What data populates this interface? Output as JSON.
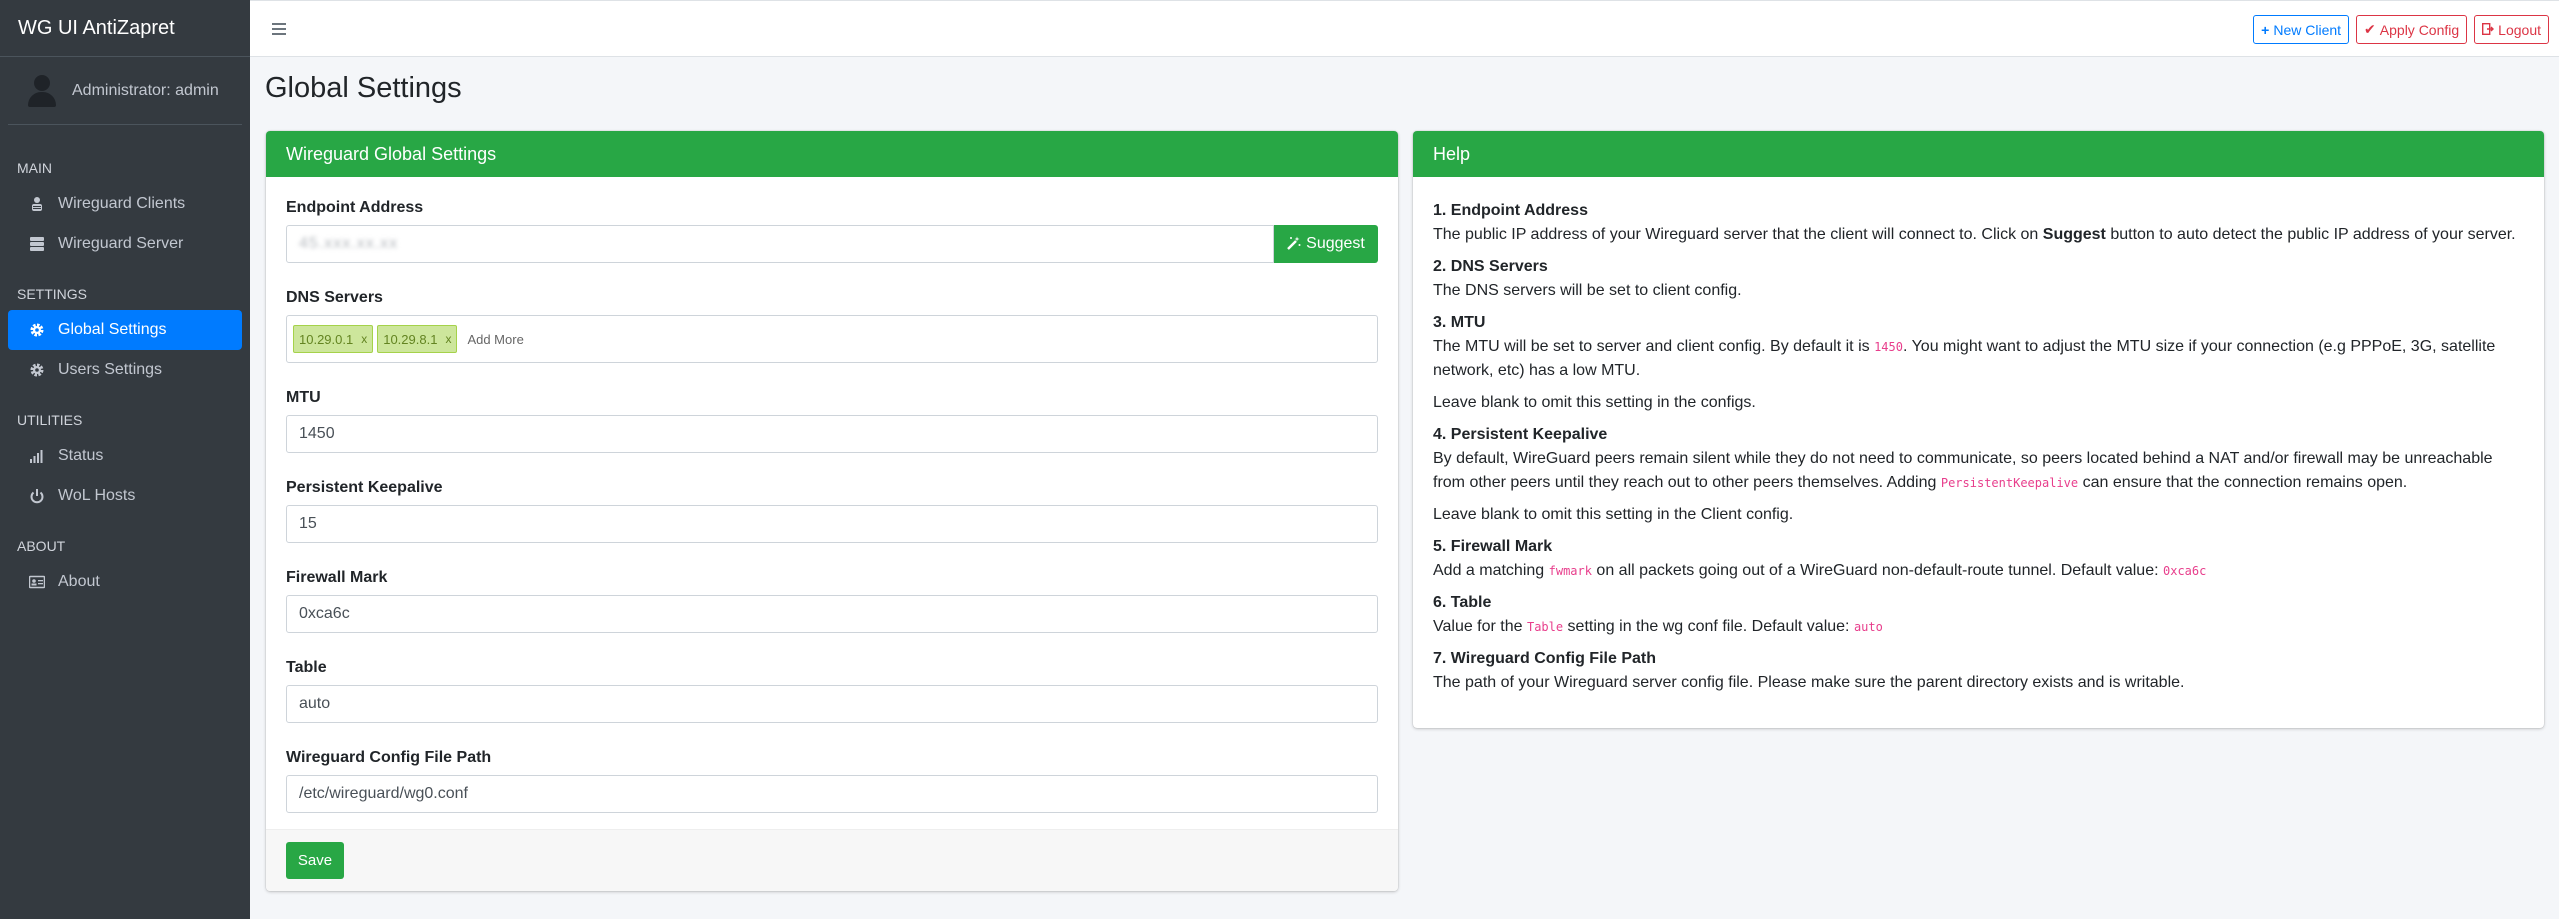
{
  "sidebar": {
    "brand": "WG UI AntiZapret",
    "user": "Administrator: admin",
    "sections": {
      "main": "MAIN",
      "settings": "SETTINGS",
      "utilities": "UTILITIES",
      "about": "ABOUT"
    },
    "items": {
      "wg_clients": "Wireguard Clients",
      "wg_server": "Wireguard Server",
      "global_settings": "Global Settings",
      "users_settings": "Users Settings",
      "status": "Status",
      "wol_hosts": "WoL Hosts",
      "about": "About"
    }
  },
  "topbar": {
    "new_client": "New Client",
    "apply_config": "Apply Config",
    "logout": "Logout"
  },
  "page": {
    "title": "Global Settings"
  },
  "settings": {
    "header": "Wireguard Global Settings",
    "endpoint_label": "Endpoint Address",
    "endpoint_value": "45.xxx.xx.xx",
    "suggest": "Suggest",
    "dns_label": "DNS Servers",
    "dns_tags": [
      "10.29.0.1",
      "10.29.8.1"
    ],
    "tag_remove": "x",
    "add_more": "Add More",
    "mtu_label": "MTU",
    "mtu_value": "1450",
    "keepalive_label": "Persistent Keepalive",
    "keepalive_value": "15",
    "fwmark_label": "Firewall Mark",
    "fwmark_value": "0xca6c",
    "table_label": "Table",
    "table_value": "auto",
    "config_path_label": "Wireguard Config File Path",
    "config_path_value": "/etc/wireguard/wg0.conf",
    "save": "Save"
  },
  "help": {
    "header": "Help",
    "s1_title": "1. Endpoint Address",
    "s1_a": "The public IP address of your Wireguard server that the client will connect to. Click on ",
    "s1_b": "Suggest",
    "s1_c": " button to auto detect the public IP address of your server.",
    "s2_title": "2. DNS Servers",
    "s2_text": "The DNS servers will be set to client config.",
    "s3_title": "3. MTU",
    "s3_a": "The MTU will be set to server and client config. By default it is ",
    "s3_code": "1450",
    "s3_b": ". You might want to adjust the MTU size if your connection (e.g PPPoE, 3G, satellite network, etc) has a low MTU.",
    "s3_note": "Leave blank to omit this setting in the configs.",
    "s4_title": "4. Persistent Keepalive",
    "s4_a": "By default, WireGuard peers remain silent while they do not need to communicate, so peers located behind a NAT and/or firewall may be unreachable from other peers until they reach out to other peers themselves. Adding ",
    "s4_code": "PersistentKeepalive",
    "s4_b": " can ensure that the connection remains open.",
    "s4_note": "Leave blank to omit this setting in the Client config.",
    "s5_title": "5. Firewall Mark",
    "s5_a": "Add a matching ",
    "s5_code1": "fwmark",
    "s5_b": " on all packets going out of a WireGuard non-default-route tunnel. Default value: ",
    "s5_code2": "0xca6c",
    "s6_title": "6. Table",
    "s6_a": "Value for the ",
    "s6_code1": "Table",
    "s6_b": " setting in the wg conf file. Default value: ",
    "s6_code2": "auto",
    "s7_title": "7. Wireguard Config File Path",
    "s7_text": "The path of your Wireguard server config file. Please make sure the parent directory exists and is writable."
  },
  "colors": {
    "sidebar_bg": "#343a40",
    "active_blue": "#007bff",
    "header_green": "#28a745",
    "danger_red": "#dc3545",
    "code_pink": "#e83e8c"
  },
  "icons": [
    "menu-icon",
    "plus-icon",
    "check-icon",
    "logout-icon",
    "user-icon",
    "users-icon",
    "server-icon",
    "gear-icon",
    "signal-icon",
    "power-icon",
    "id-card-icon",
    "magic-wand-icon"
  ]
}
